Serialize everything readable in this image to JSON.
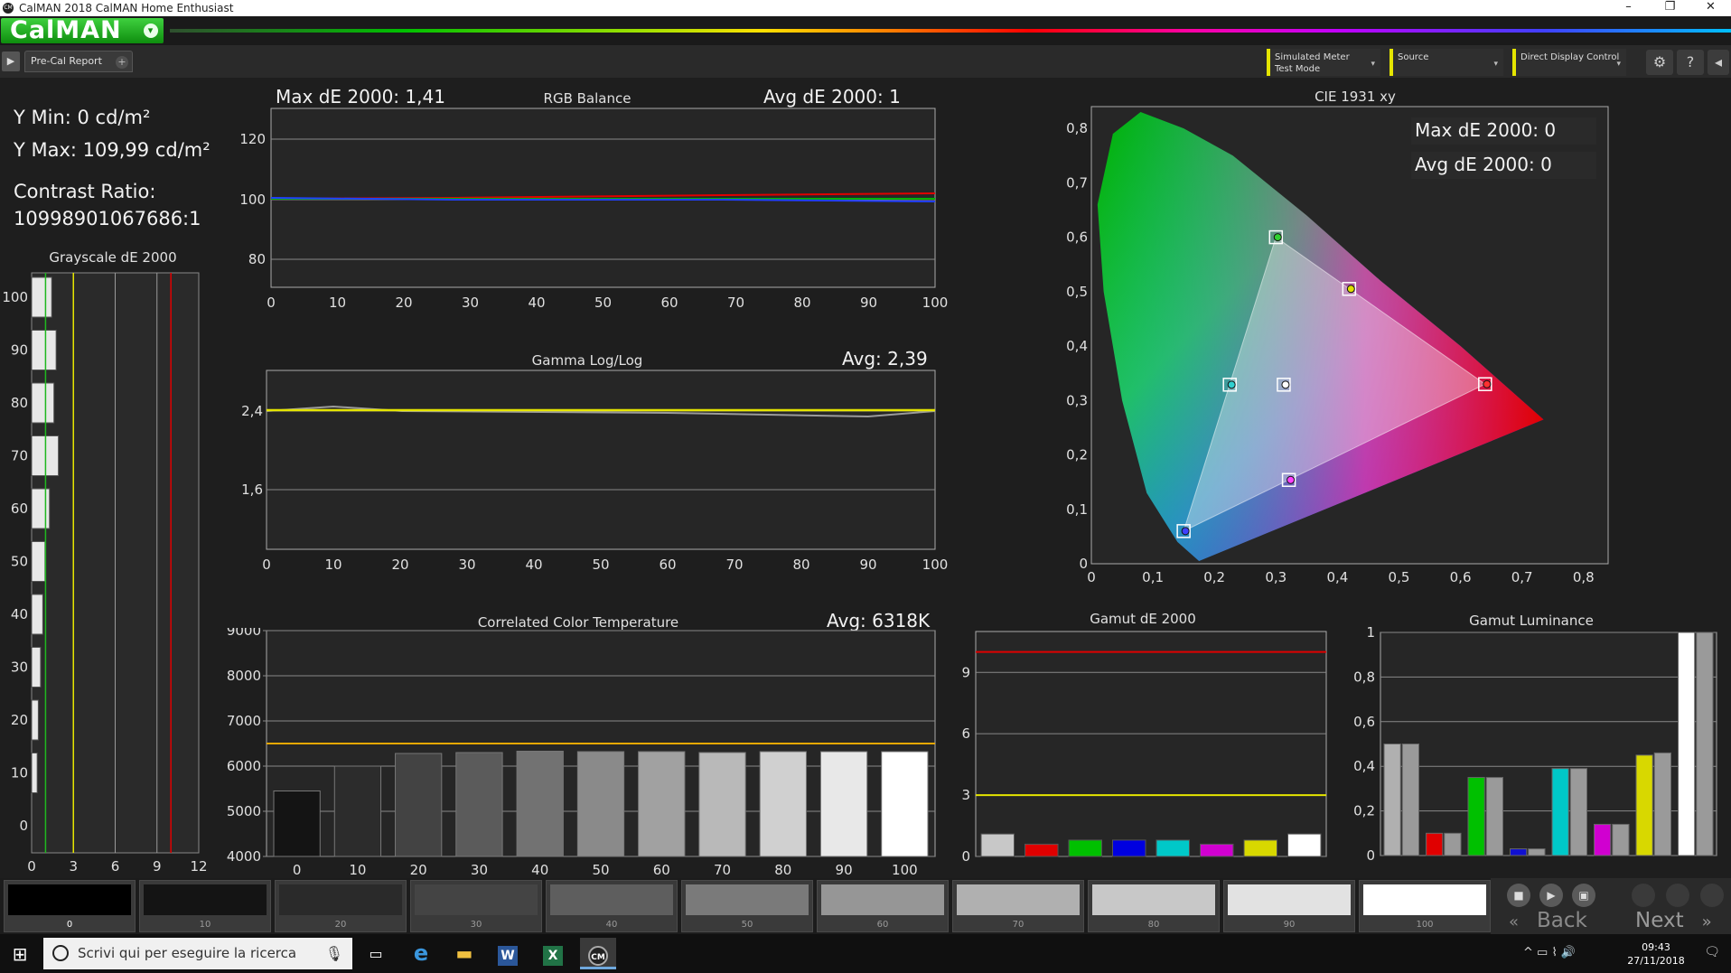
{
  "window": {
    "title": "CalMAN 2018 CalMAN Home Enthusiast",
    "minimize": "–",
    "restore": "❐",
    "close": "✕"
  },
  "header": {
    "logo_text": "CalMAN",
    "logo_drop": "▾"
  },
  "toolbar": {
    "play": "▶",
    "tab_label": "Pre-Cal Report",
    "tab_add": "+",
    "meter_line1": "Simulated Meter",
    "meter_line2": "Test Mode",
    "source_label": "Source",
    "display_label": "Direct Display Control",
    "chevron": "▾",
    "settings_icon": "⚙",
    "help_icon": "?",
    "back_icon": "◂"
  },
  "summary": {
    "ymin": "Y Min: 0 cd/m²",
    "ymax": "Y Max: 109,99 cd/m²",
    "contrast_label": "Contrast Ratio:",
    "contrast_value": "10998901067686:1"
  },
  "grayscale": {
    "title": "Grayscale dE 2000",
    "y_ticks": [
      "100",
      "90",
      "80",
      "70",
      "60",
      "50",
      "40",
      "30",
      "20",
      "10",
      "0"
    ],
    "x_ticks": [
      "0",
      "3",
      "6",
      "9",
      "12"
    ],
    "bars": [
      {
        "level": 100,
        "de": 0.9
      },
      {
        "level": 90,
        "de": 1.1
      },
      {
        "level": 80,
        "de": 1.0
      },
      {
        "level": 70,
        "de": 1.2
      },
      {
        "level": 60,
        "de": 0.8
      },
      {
        "level": 50,
        "de": 0.6
      },
      {
        "level": 40,
        "de": 0.5
      },
      {
        "level": 30,
        "de": 0.4
      },
      {
        "level": 20,
        "de": 0.3
      },
      {
        "level": 10,
        "de": 0.25
      }
    ],
    "lines": [
      {
        "value": 1,
        "color": "#1fb81f"
      },
      {
        "value": 3,
        "color": "#e5e500"
      },
      {
        "value": 10,
        "color": "#e00000"
      }
    ]
  },
  "rgb_balance": {
    "title": "RGB Balance",
    "max_de": "Max dE 2000: 1,41",
    "avg_de": "Avg dE 2000: 1",
    "y_ticks": [
      "120",
      "100",
      "80"
    ],
    "x_ticks": [
      "0",
      "10",
      "20",
      "30",
      "40",
      "50",
      "60",
      "70",
      "80",
      "90",
      "100"
    ]
  },
  "gamma": {
    "title": "Gamma Log/Log",
    "avg": "Avg: 2,39",
    "y_ticks": [
      "2,4",
      "1,6"
    ],
    "x_ticks": [
      "0",
      "10",
      "20",
      "30",
      "40",
      "50",
      "60",
      "70",
      "80",
      "90",
      "100"
    ]
  },
  "cct": {
    "title": "Correlated Color Temperature",
    "avg": "Avg: 6318K",
    "y_ticks": [
      "9000",
      "8000",
      "7000",
      "6000",
      "5000",
      "4000"
    ],
    "x_ticks": [
      "0",
      "10",
      "20",
      "30",
      "40",
      "50",
      "60",
      "70",
      "80",
      "90",
      "100"
    ],
    "values": [
      5450,
      6000,
      6280,
      6300,
      6330,
      6320,
      6320,
      6300,
      6320,
      6320,
      6320
    ],
    "target": 6500
  },
  "gamut_de": {
    "title": "Gamut dE 2000",
    "y_ticks": [
      "9",
      "6",
      "3",
      "0"
    ],
    "values": [
      1.1,
      0.6,
      0.8,
      0.8,
      0.8,
      0.6,
      0.8,
      1.1
    ],
    "colors": [
      "#c8c8c8",
      "#e00000",
      "#00c000",
      "#0000e0",
      "#00c8c8",
      "#d000d0",
      "#d8d800",
      "#ffffff"
    ]
  },
  "gamut_lum": {
    "title": "Gamut Luminance",
    "y_ticks": [
      "1",
      "0,8",
      "0,6",
      "0,4",
      "0,2",
      "0"
    ],
    "pairs": [
      {
        "color": "#b0b0b0",
        "a": 0.5,
        "b": 0.5
      },
      {
        "color": "#e00000",
        "a": 0.1,
        "b": 0.1
      },
      {
        "color": "#00c000",
        "a": 0.35,
        "b": 0.35
      },
      {
        "color": "#1010d0",
        "a": 0.03,
        "b": 0.03
      },
      {
        "color": "#00c8c8",
        "a": 0.39,
        "b": 0.39
      },
      {
        "color": "#d000d0",
        "a": 0.14,
        "b": 0.14
      },
      {
        "color": "#d8d800",
        "a": 0.45,
        "b": 0.46
      },
      {
        "color": "#ffffff",
        "a": 1.0,
        "b": 1.0
      }
    ]
  },
  "cie": {
    "title": "CIE 1931 xy",
    "max_de": "Max dE 2000: 0",
    "avg_de": "Avg dE 2000: 0",
    "y_ticks": [
      "0,8",
      "0,7",
      "0,6",
      "0,5",
      "0,4",
      "0,3",
      "0,2",
      "0,1",
      "0"
    ],
    "x_ticks": [
      "0",
      "0,1",
      "0,2",
      "0,3",
      "0,4",
      "0,5",
      "0,6",
      "0,7",
      "0,8"
    ],
    "targets": [
      {
        "x": 0.64,
        "y": 0.33,
        "color": "#ff3030"
      },
      {
        "x": 0.3,
        "y": 0.6,
        "color": "#30d030"
      },
      {
        "x": 0.15,
        "y": 0.06,
        "color": "#4040ff"
      },
      {
        "x": 0.225,
        "y": 0.329,
        "color": "#30d0d0"
      },
      {
        "x": 0.321,
        "y": 0.154,
        "color": "#ff40ff"
      },
      {
        "x": 0.419,
        "y": 0.505,
        "color": "#e0e000"
      },
      {
        "x": 0.3127,
        "y": 0.329,
        "color": "#ffffff"
      }
    ]
  },
  "patches": [
    {
      "label": "0",
      "gray": "#000000"
    },
    {
      "label": "10",
      "gray": "#141414"
    },
    {
      "label": "20",
      "gray": "#2a2a2a"
    },
    {
      "label": "30",
      "gray": "#444444"
    },
    {
      "label": "40",
      "gray": "#5e5e5e"
    },
    {
      "label": "50",
      "gray": "#7a7a7a"
    },
    {
      "label": "60",
      "gray": "#969696"
    },
    {
      "label": "70",
      "gray": "#b0b0b0"
    },
    {
      "label": "80",
      "gray": "#c8c8c8"
    },
    {
      "label": "90",
      "gray": "#e2e2e2"
    },
    {
      "label": "100",
      "gray": "#ffffff"
    }
  ],
  "nav": {
    "stop": "■",
    "play": "▶",
    "save": "▣",
    "back": "Back",
    "next": "Next",
    "back_arrow": "«",
    "next_arrow": "»"
  },
  "taskbar": {
    "start_icon": "⊞",
    "search_placeholder": "Scrivi qui per eseguire la ricerca",
    "mic_icon": "🎙",
    "taskview_icon": "▭",
    "edge_icon": "e",
    "explorer_icon": "▬",
    "word_icon": "W",
    "excel_icon": "X",
    "calman_icon": "CM",
    "tray_icons": "^ ▭ ⌇ 🔊",
    "time": "09:43",
    "date": "27/11/2018",
    "notification_icon": "🗨"
  }
}
